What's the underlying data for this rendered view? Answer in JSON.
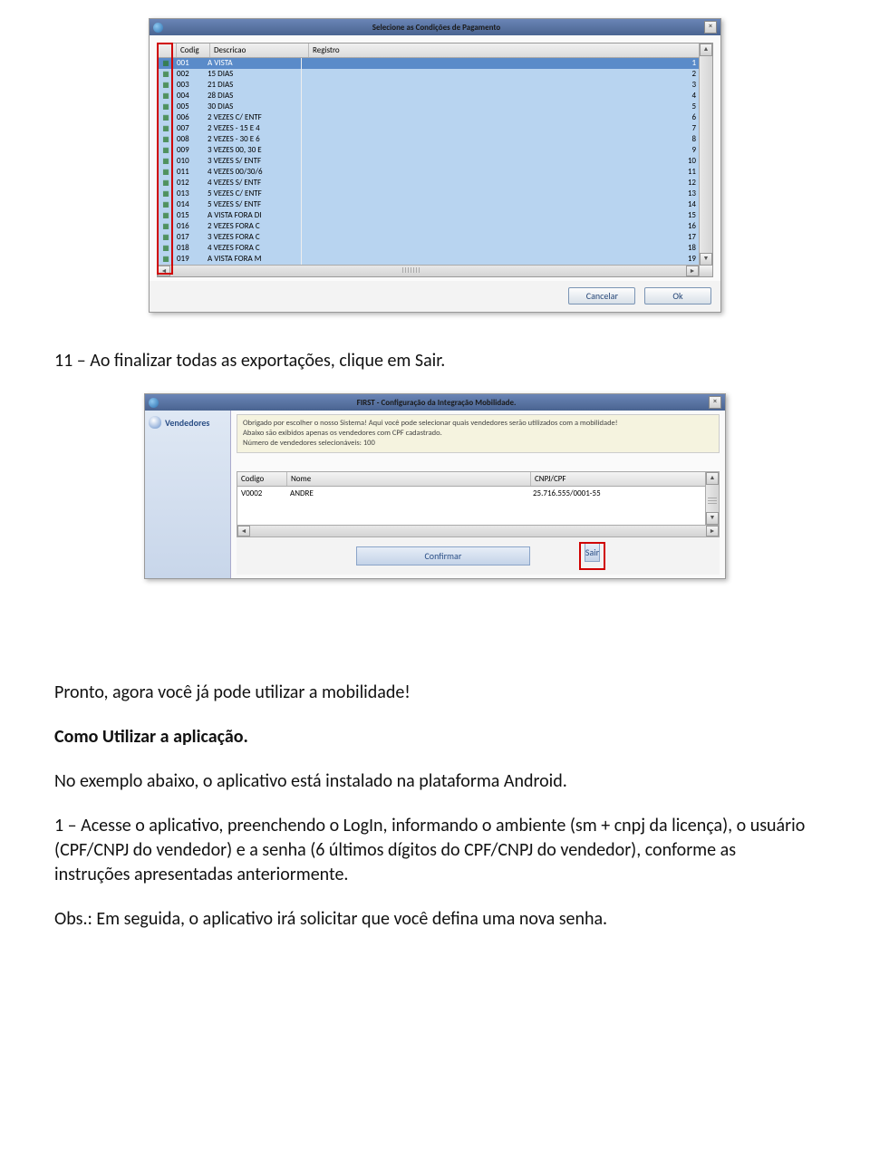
{
  "dialog1": {
    "title": "Selecione as Condições de Pagamento",
    "columns": {
      "codigo": "Codig",
      "descricao": "Descricao",
      "registro": "Registro"
    },
    "rows": [
      {
        "codigo": "001",
        "desc": "A VISTA",
        "reg": "1"
      },
      {
        "codigo": "002",
        "desc": "15 DIAS",
        "reg": "2"
      },
      {
        "codigo": "003",
        "desc": "21 DIAS",
        "reg": "3"
      },
      {
        "codigo": "004",
        "desc": "28 DIAS",
        "reg": "4"
      },
      {
        "codigo": "005",
        "desc": "30 DIAS",
        "reg": "5"
      },
      {
        "codigo": "006",
        "desc": "2 VEZES C/ ENTF",
        "reg": "6"
      },
      {
        "codigo": "007",
        "desc": "2 VEZES - 15 E 4",
        "reg": "7"
      },
      {
        "codigo": "008",
        "desc": "2 VEZES - 30 E 6",
        "reg": "8"
      },
      {
        "codigo": "009",
        "desc": "3 VEZES 00, 30 E",
        "reg": "9"
      },
      {
        "codigo": "010",
        "desc": "3 VEZES S/ ENTF",
        "reg": "10"
      },
      {
        "codigo": "011",
        "desc": "4 VEZES 00/30/6",
        "reg": "11"
      },
      {
        "codigo": "012",
        "desc": "4 VEZES S/ ENTF",
        "reg": "12"
      },
      {
        "codigo": "013",
        "desc": "5 VEZES C/ ENTF",
        "reg": "13"
      },
      {
        "codigo": "014",
        "desc": "5 VEZES S/ ENTF",
        "reg": "14"
      },
      {
        "codigo": "015",
        "desc": "A VISTA FORA DI",
        "reg": "15"
      },
      {
        "codigo": "016",
        "desc": "2 VEZES FORA C",
        "reg": "16"
      },
      {
        "codigo": "017",
        "desc": "3 VEZES FORA C",
        "reg": "17"
      },
      {
        "codigo": "018",
        "desc": "4 VEZES FORA C",
        "reg": "18"
      },
      {
        "codigo": "019",
        "desc": "A VISTA FORA M",
        "reg": "19"
      }
    ],
    "buttons": {
      "cancel": "Cancelar",
      "ok": "Ok"
    }
  },
  "doc": {
    "step11": "11 – Ao finalizar todas as exportações, clique em Sair.",
    "pronto": "Pronto, agora você já pode utilizar a mobilidade!",
    "como": "Como Utilizar a aplicação.",
    "exemplo": "No exemplo abaixo, o aplicativo está instalado na plataforma Android.",
    "step1": "1 – Acesse o aplicativo, preenchendo o LogIn, informando o ambiente (sm + cnpj da licença), o usuário (CPF/CNPJ do vendedor) e a senha (6 últimos dígitos do CPF/CNPJ do vendedor), conforme as instruções apresentadas anteriormente.",
    "obs": "Obs.:  Em seguida, o aplicativo irá solicitar que você defina uma nova senha."
  },
  "dialog2": {
    "title": "FIRST - Configuração da Integração Mobilidade.",
    "side": "Vendedores",
    "info1": "Obrigado por escolher o nosso Sistema! Aqui você pode selecionar quais vendedores serão utilizados com a mobilidade!",
    "info2": "Abaixo são exibidos apenas os vendedores com CPF cadastrado.",
    "info3": "Número de vendedores selecionáveis: 100",
    "cols": {
      "codigo": "Codigo",
      "nome": "Nome",
      "cnpj": "CNPJ/CPF"
    },
    "row": {
      "codigo": "V0002",
      "nome": "ANDRE",
      "cnpj": "25.716.555/0001-55"
    },
    "buttons": {
      "confirmar": "Confirmar",
      "sair": "Sair"
    }
  }
}
